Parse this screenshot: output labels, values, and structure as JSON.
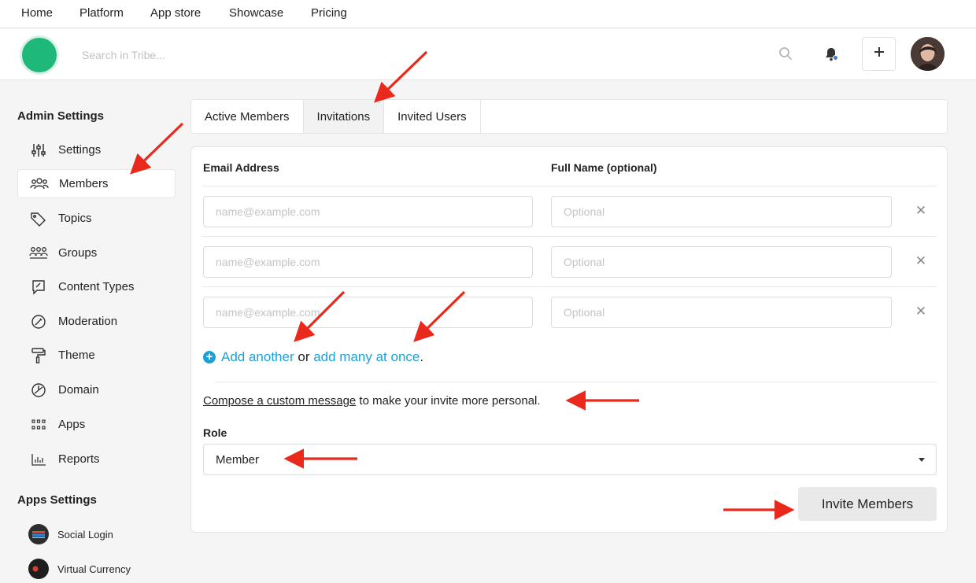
{
  "site_nav": {
    "items": [
      "Home",
      "Platform",
      "App store",
      "Showcase",
      "Pricing"
    ]
  },
  "header": {
    "search_placeholder": "Search in Tribe...",
    "icons": [
      "search-icon",
      "bell-icon",
      "plus-icon"
    ]
  },
  "sidebar": {
    "admin_heading": "Admin Settings",
    "items": [
      {
        "label": "Settings",
        "icon": "sliders-icon"
      },
      {
        "label": "Members",
        "icon": "members-icon"
      },
      {
        "label": "Topics",
        "icon": "tag-icon"
      },
      {
        "label": "Groups",
        "icon": "groups-icon"
      },
      {
        "label": "Content Types",
        "icon": "content-types-icon"
      },
      {
        "label": "Moderation",
        "icon": "moderation-icon"
      },
      {
        "label": "Theme",
        "icon": "paint-roller-icon"
      },
      {
        "label": "Domain",
        "icon": "domain-icon"
      },
      {
        "label": "Apps",
        "icon": "apps-grid-icon"
      },
      {
        "label": "Reports",
        "icon": "bar-chart-icon"
      }
    ],
    "active_item": "Members",
    "apps_heading": "Apps Settings",
    "apps": [
      {
        "label": "Social Login"
      },
      {
        "label": "Virtual Currency"
      }
    ]
  },
  "tabs": [
    {
      "label": "Active Members"
    },
    {
      "label": "Invitations"
    },
    {
      "label": "Invited Users"
    }
  ],
  "active_tab": "Invitations",
  "invite": {
    "email_header": "Email Address",
    "name_header": "Full Name (optional)",
    "email_placeholder": "name@example.com",
    "name_placeholder": "Optional",
    "remove_glyph": "✕",
    "add_another": "Add another",
    "or_text": " or ",
    "add_many": "add many at once",
    "period": ".",
    "compose_link": "Compose a custom message",
    "compose_rest": " to make your invite more personal.",
    "role_label": "Role",
    "role_value": "Member",
    "invite_button": "Invite Members"
  },
  "colors": {
    "accent": "#1ca1d6",
    "logo": "#1db87a",
    "arrow": "#e8291c"
  }
}
